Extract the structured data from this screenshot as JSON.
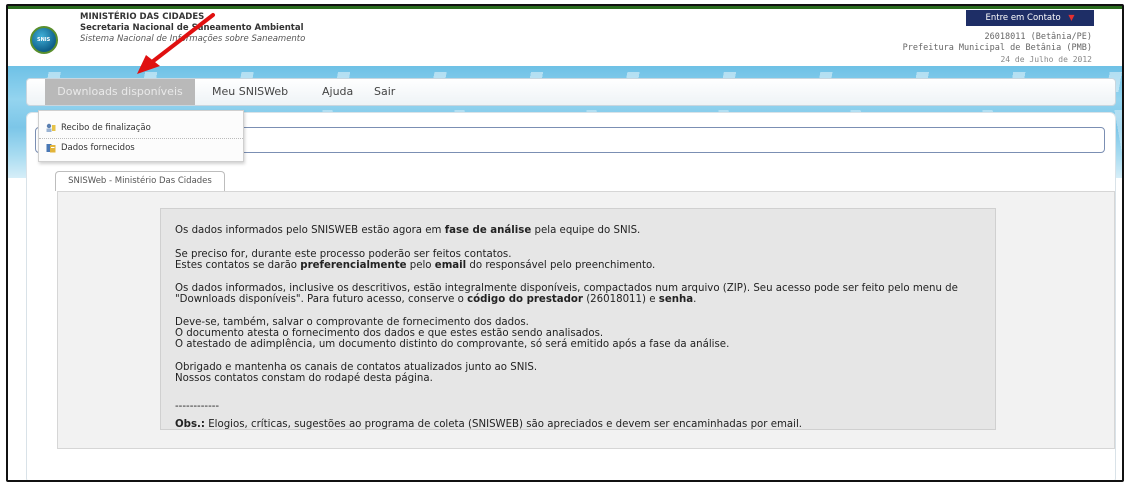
{
  "header": {
    "ministry": "MINISTÉRIO DAS CIDADES",
    "secretaria": "Secretaria Nacional de Saneamento Ambiental",
    "sistema": "Sistema Nacional de Informações sobre Saneamento",
    "logo_text": "SNIS"
  },
  "contact": {
    "label": "Entre em Contato"
  },
  "user": {
    "code": "26018011 (Betânia/PE)",
    "org": "Prefeitura Municipal de Betânia (PMB)",
    "date": "24 de Julho de 2012"
  },
  "menu": {
    "downloads": "Downloads disponíveis",
    "meu": "Meu SNISWeb",
    "ajuda": "Ajuda",
    "sair": "Sair"
  },
  "dropdown": {
    "item1": "Recibo de finalização",
    "item2": "Dados fornecidos"
  },
  "tab": {
    "label": "SNISWeb - Ministério Das Cidades"
  },
  "notice": {
    "p1a": "Os dados informados pelo SNISWEB estão agora em ",
    "p1b": "fase de análise",
    "p1c": " pela equipe do SNIS.",
    "p2a": "Se preciso for, durante este processo poderão ser feitos contatos.",
    "p2b": "Estes contatos se darão ",
    "p2c": "preferencialmente",
    "p2d": " pelo ",
    "p2e": "email",
    "p2f": " do responsável pelo preenchimento.",
    "p3a": "Os dados informados, inclusive os descritivos, estão integralmente disponíveis, compactados num arquivo (ZIP).  Seu acesso pode ser feito pelo menu de",
    "p3b": "\"Downloads disponíveis\". Para futuro acesso, conserve o ",
    "p3c": "código do prestador",
    "p3d": " (26018011) e ",
    "p3e": "senha",
    "p3f": ".",
    "p4a": "Deve-se, também, salvar o comprovante de fornecimento dos dados.",
    "p4b": "O documento atesta o fornecimento dos dados e que estes estão sendo analisados.",
    "p4c": "O atestado de adimplência, um documento distinto do comprovante, só será emitido após a fase da análise.",
    "p5a": "Obrigado e mantenha os canais de contatos atualizados junto ao SNIS.",
    "p5b": "Nossos contatos constam do rodapé desta página.",
    "sep": "------------",
    "obs_label": "Obs.:",
    "obs_text": " Elogios, críticas, sugestões ao programa de coleta (SNISWEB) são apreciados e devem ser encaminhadas por email."
  },
  "colors": {
    "header_green": "#2a6b1e",
    "contact_bg": "#1e2e66",
    "menu_active_bg": "#b9b9b9",
    "arrow": "#e01010"
  }
}
